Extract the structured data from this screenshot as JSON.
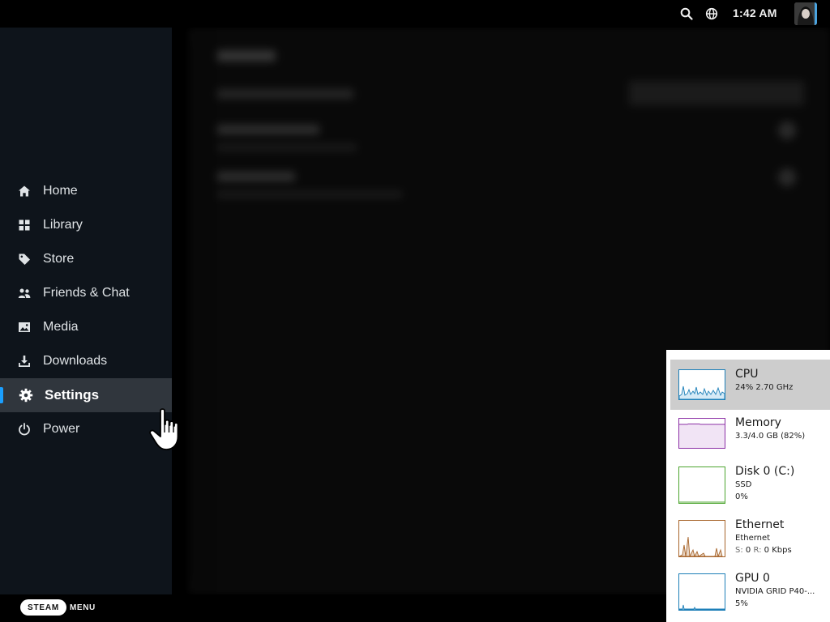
{
  "topbar": {
    "time": "1:42 AM",
    "icons": [
      "search-icon",
      "globe-icon"
    ]
  },
  "sidebar": {
    "items": [
      {
        "label": "Home",
        "icon": "home-icon"
      },
      {
        "label": "Library",
        "icon": "grid-icon"
      },
      {
        "label": "Store",
        "icon": "tag-icon"
      },
      {
        "label": "Friends & Chat",
        "icon": "friends-icon"
      },
      {
        "label": "Media",
        "icon": "image-icon"
      },
      {
        "label": "Downloads",
        "icon": "download-icon"
      },
      {
        "label": "Settings",
        "icon": "gear-icon",
        "active": true
      },
      {
        "label": "Power",
        "icon": "power-icon"
      }
    ]
  },
  "bottombar": {
    "steam_label": "STEAM",
    "menu_label": "MENU"
  },
  "taskmanager": {
    "items": [
      {
        "name": "CPU",
        "line1": "24% 2.70 GHz",
        "color": "#1d7fb8",
        "selected": true
      },
      {
        "name": "Memory",
        "line1": "3.3/4.0 GB (82%)",
        "color": "#8b2fa5"
      },
      {
        "name": "Disk 0 (C:)",
        "line1": "SSD",
        "line2": "0%",
        "color": "#4ca52f"
      },
      {
        "name": "Ethernet",
        "line1": "Ethernet",
        "line2_s": "S:",
        "line2_s_val": "0",
        "line2_r": "R:",
        "line2_r_val": "0 Kbps",
        "color": "#a8652b"
      },
      {
        "name": "GPU 0",
        "line1": "NVIDIA GRID P40-...",
        "line2": "5%",
        "color": "#1d7fb8"
      }
    ]
  },
  "colors": {
    "accent": "#1a9fff",
    "sidebar_bg": "#0e141b",
    "active_bg": "#30363d"
  }
}
